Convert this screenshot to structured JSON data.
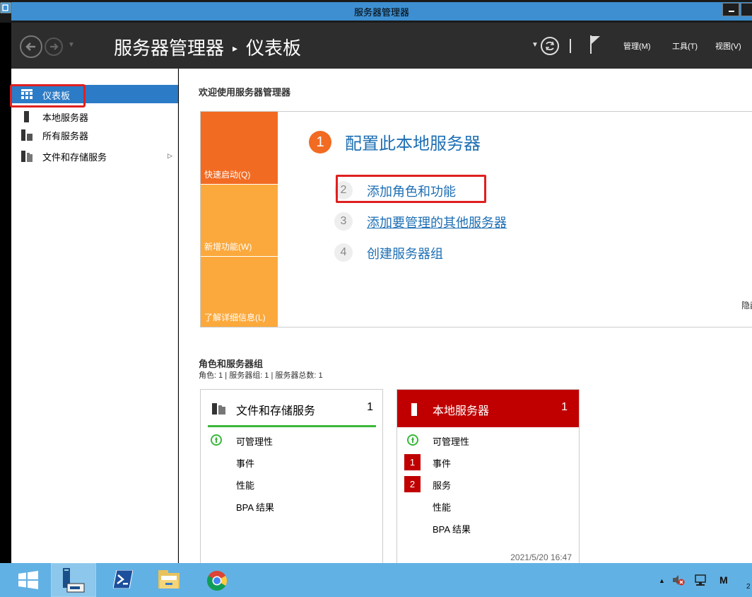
{
  "window": {
    "title": "服务器管理器"
  },
  "header": {
    "breadcrumb_app": "服务器管理器",
    "breadcrumb_sep": "▸",
    "breadcrumb_page": "仪表板",
    "menus": [
      {
        "label": "管理(M)"
      },
      {
        "label": "工具(T)"
      },
      {
        "label": "视图(V)"
      }
    ]
  },
  "sidebar": {
    "items": [
      {
        "label": "仪表板",
        "icon": "dashboard-icon",
        "selected": true
      },
      {
        "label": "本地服务器",
        "icon": "server-icon"
      },
      {
        "label": "所有服务器",
        "icon": "servers-icon"
      },
      {
        "label": "文件和存储服务",
        "icon": "file-storage-icon",
        "expandable": true
      }
    ]
  },
  "main": {
    "welcome_title": "欢迎使用服务器管理器",
    "quickstart": {
      "tiles": [
        {
          "label": "快速启动(Q)",
          "color": "#f26b22"
        },
        {
          "label": "新增功能(W)",
          "color": "#fba93c"
        },
        {
          "label": "了解详细信息(L)",
          "color": "#fba93c"
        }
      ],
      "step1_number": "1",
      "step1_label": "配置此本地服务器",
      "steps": [
        {
          "number": "2",
          "label": "添加角色和功能"
        },
        {
          "number": "3",
          "label": "添加要管理的其他服务器"
        },
        {
          "number": "4",
          "label": "创建服务器组"
        }
      ],
      "hide_label": "隐藏"
    },
    "roles": {
      "title": "角色和服务器组",
      "subtitle": "角色: 1 | 服务器组: 1 | 服务器总数: 1",
      "cards": [
        {
          "title": "文件和存储服务",
          "count": "1",
          "rows": [
            {
              "label": "可管理性",
              "status": "up"
            },
            {
              "label": "事件"
            },
            {
              "label": "性能"
            },
            {
              "label": "BPA 结果"
            }
          ]
        },
        {
          "title": "本地服务器",
          "count": "1",
          "rows": [
            {
              "label": "可管理性",
              "status": "up"
            },
            {
              "label": "事件",
              "badge": "1"
            },
            {
              "label": "服务",
              "badge": "2"
            },
            {
              "label": "性能"
            },
            {
              "label": "BPA 结果"
            }
          ],
          "timestamp": "2021/5/20 16:47"
        }
      ]
    }
  },
  "taskbar": {
    "apps": [
      "windows-start-icon",
      "server-manager-icon",
      "powershell-icon",
      "file-explorer-icon",
      "chrome-icon"
    ],
    "tray": {
      "ime": "M",
      "clock_partial": "2"
    }
  },
  "colors": {
    "accent_blue": "#2c7bc7",
    "orange": "#f26b22",
    "light_orange": "#fba93c",
    "alert_red": "#c00000",
    "ok_green": "#3bb73b",
    "highlight_red": "#e02020"
  }
}
